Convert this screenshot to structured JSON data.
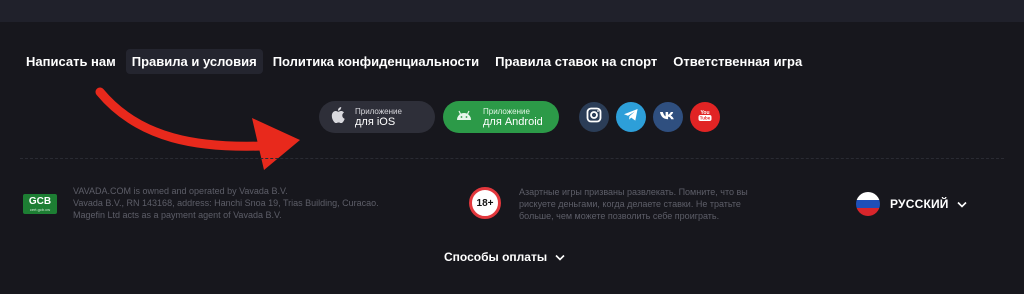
{
  "footer_nav": {
    "items": [
      {
        "label": "Написать нам"
      },
      {
        "label": "Правила и условия"
      },
      {
        "label": "Политика конфиденциальности"
      },
      {
        "label": "Правила ставок на спорт"
      },
      {
        "label": "Ответственная игра"
      }
    ],
    "active_index": 1
  },
  "apps": {
    "ios": {
      "small": "Приложение",
      "big": "для iOS",
      "icon": "apple-icon"
    },
    "android": {
      "small": "Приложение",
      "big": "для Android",
      "icon": "android-icon"
    }
  },
  "social": [
    "instagram-icon",
    "telegram-icon",
    "vk-icon",
    "youtube-icon"
  ],
  "license": {
    "badge": "GCB",
    "badge_sub": "cert.gcb.cw",
    "lines": [
      "VAVADA.COM is owned and operated by Vavada B.V.",
      "Vavada B.V., RN 143168, address: Hanchi Snoa 19, Trias Building, Curacao.",
      "Magefin Ltd acts as a payment agent of Vavada B.V."
    ]
  },
  "age_badge": "18+",
  "responsible_text": [
    "Азартные игры призваны развлекать. Помните, что вы",
    "рискуете деньгами, когда делаете ставки. Не тратьте",
    "больше, чем можете позволить себе проиграть."
  ],
  "language": {
    "label": "РУССКИЙ",
    "flag": "russia-flag-icon"
  },
  "payment_methods": {
    "label": "Способы оплаты"
  },
  "colors": {
    "background": "#17171d",
    "android_green": "#2c9a48",
    "age_red": "#e2373c",
    "arrow_red": "#e8291c"
  }
}
